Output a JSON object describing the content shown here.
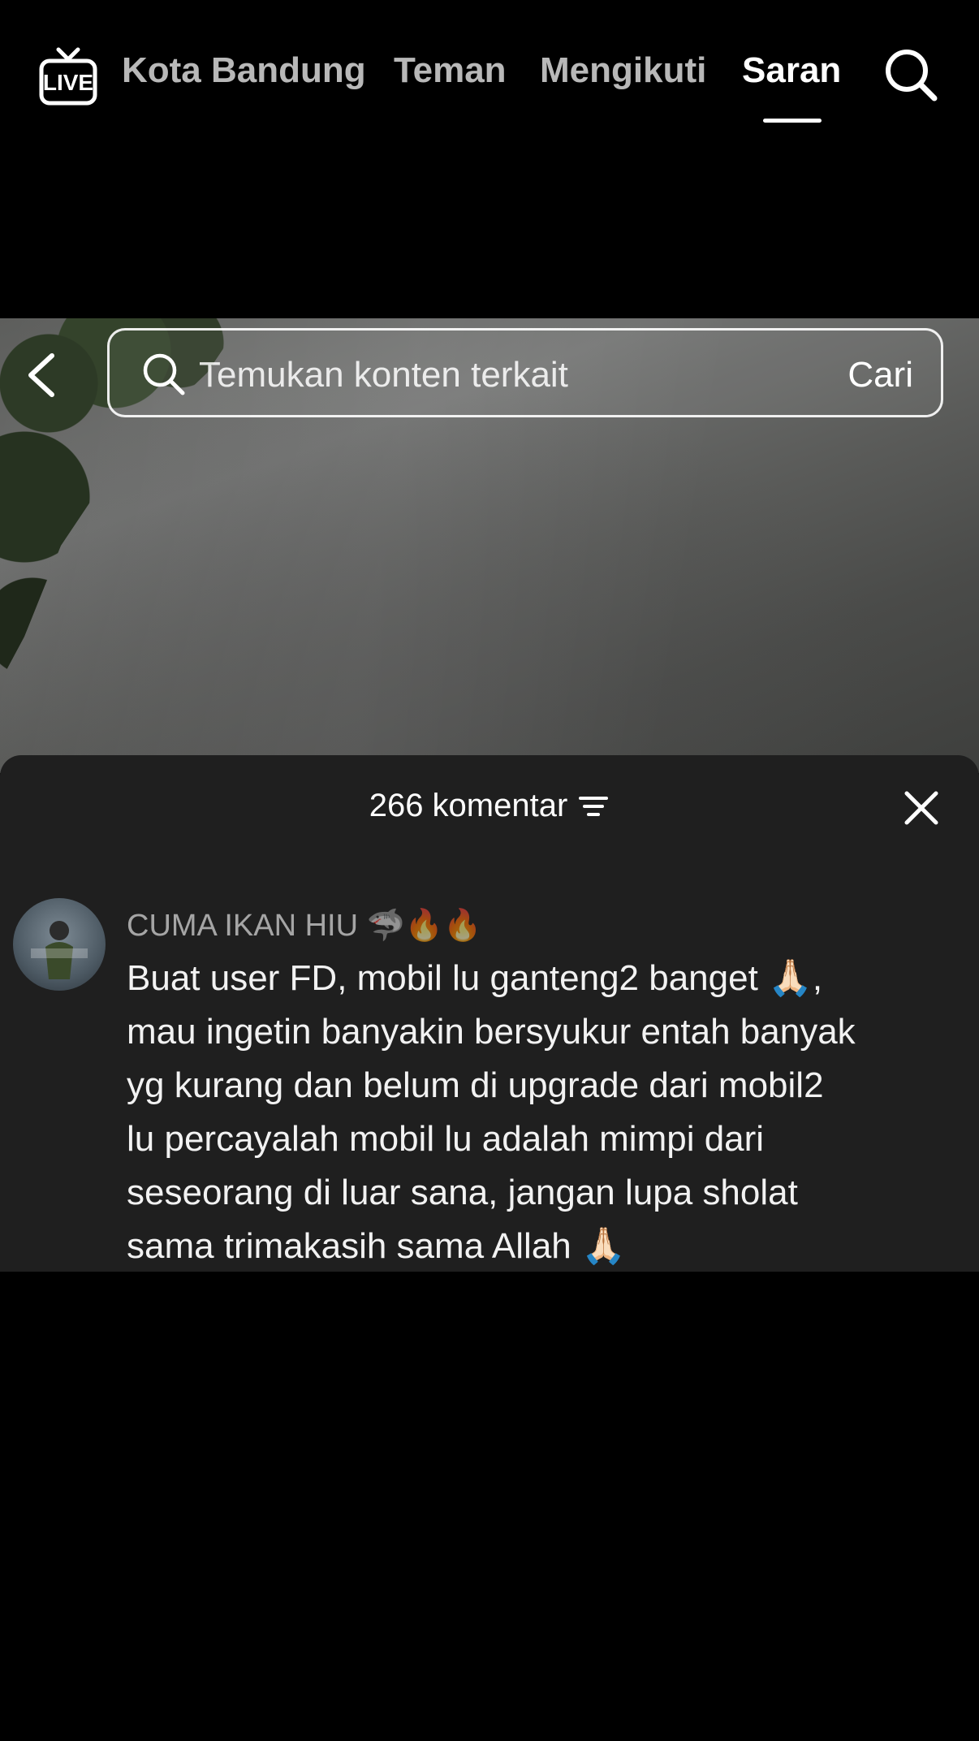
{
  "topnav": {
    "live_label": "LIVE",
    "tabs": [
      {
        "label": "Kota Bandung"
      },
      {
        "label": "Teman"
      },
      {
        "label": "Mengikuti"
      },
      {
        "label": "Saran"
      }
    ],
    "active_tab": "Saran"
  },
  "search": {
    "placeholder": "Temukan konten terkait",
    "button_label": "Cari"
  },
  "comments": {
    "count_label": "266 komentar",
    "items": [
      {
        "username": "CUMA IKAN HIU  🦈🔥🔥",
        "text": "Buat user FD, mobil lu ganteng2 banget 🙏🏻,\nmau ingetin banyakin bersyukur entah banyak\nyg kurang dan belum di upgrade dari mobil2\nlu percayalah mobil lu adalah mimpi dari\nseseorang di luar sana, jangan lupa sholat\nsama trimakasih sama Allah 🙏🏻"
      }
    ]
  }
}
